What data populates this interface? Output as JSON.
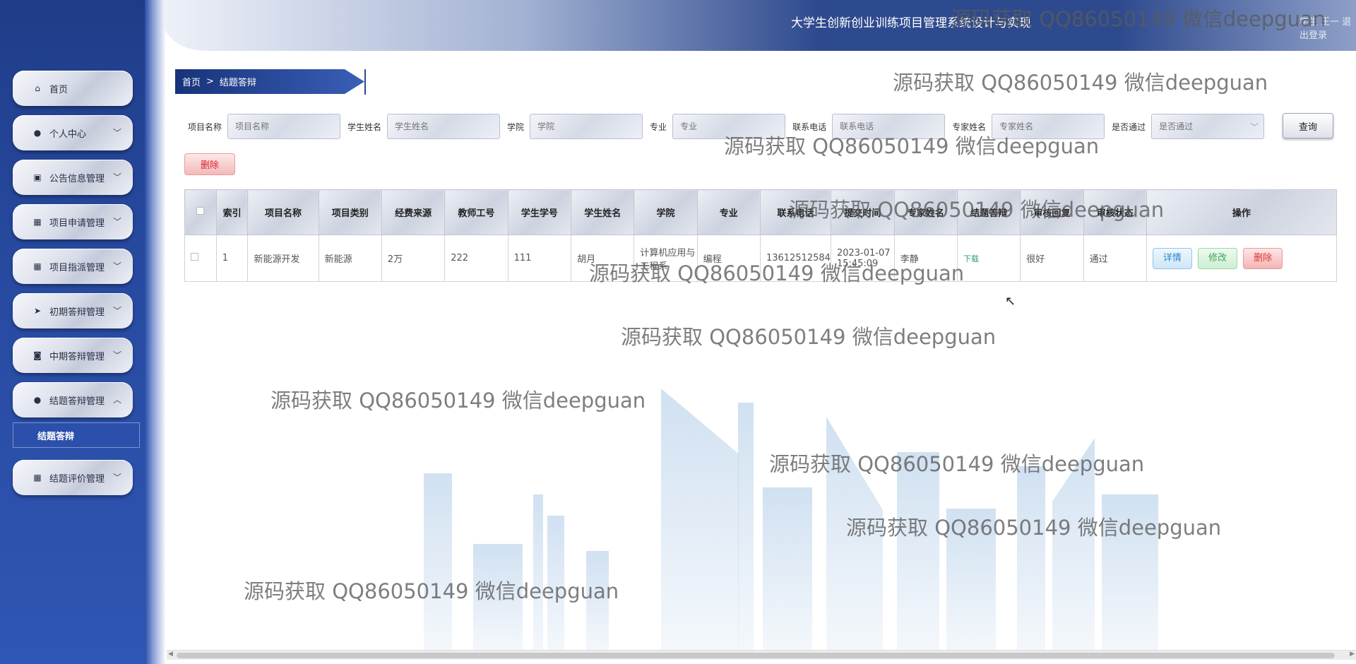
{
  "header": {
    "title": "大学生创新创业训练项目管理系统设计与实现",
    "user_text": "学生 王一 退出登录"
  },
  "sidebar": {
    "items": [
      {
        "label": "首页",
        "icon": "home-icon",
        "glyph": "⌂",
        "has_chevron": false
      },
      {
        "label": "个人中心",
        "icon": "user-icon",
        "glyph": "●",
        "has_chevron": true
      },
      {
        "label": "公告信息管理",
        "icon": "clipboard-icon",
        "glyph": "▣",
        "has_chevron": true
      },
      {
        "label": "项目申请管理",
        "icon": "grid-icon",
        "glyph": "▦",
        "has_chevron": true
      },
      {
        "label": "项目指派管理",
        "icon": "grid-icon",
        "glyph": "▦",
        "has_chevron": true
      },
      {
        "label": "初期答辩管理",
        "icon": "send-icon",
        "glyph": "➤",
        "has_chevron": true
      },
      {
        "label": "中期答辩管理",
        "icon": "video-icon",
        "glyph": "◙",
        "has_chevron": true
      },
      {
        "label": "结题答辩管理",
        "icon": "lightbulb-icon",
        "glyph": "●",
        "has_chevron": true,
        "expanded": true
      }
    ],
    "submenu_label": "结题答辩",
    "last_item": {
      "label": "结题评价管理",
      "icon": "grid-icon",
      "glyph": "▦"
    }
  },
  "breadcrumb": {
    "home": "首页",
    "sep": ">",
    "current": "结题答辩"
  },
  "search": {
    "fields": [
      {
        "label": "项目名称",
        "placeholder": "项目名称"
      },
      {
        "label": "学生姓名",
        "placeholder": "学生姓名"
      },
      {
        "label": "学院",
        "placeholder": "学院"
      },
      {
        "label": "专业",
        "placeholder": "专业"
      },
      {
        "label": "联系电话",
        "placeholder": "联系电话"
      },
      {
        "label": "专家姓名",
        "placeholder": "专家姓名"
      }
    ],
    "pass_label": "是否通过",
    "pass_placeholder": "是否通过",
    "query_button": "查询"
  },
  "delete_button": "删除",
  "table": {
    "headers": [
      "索引",
      "项目名称",
      "项目类别",
      "经费来源",
      "教师工号",
      "学生学号",
      "学生姓名",
      "学院",
      "专业",
      "联系电话",
      "提交时间",
      "专家姓名",
      "结题答辩",
      "审核回复",
      "审核状态",
      "操作"
    ],
    "rows": [
      {
        "index": "1",
        "name": "新能源开发",
        "category": "新能源",
        "funding": "2万",
        "teacher_id": "222",
        "student_id": "111",
        "student_name": "胡月",
        "college": "计算机应用与工程系",
        "major": "编程",
        "phone": "13612512584",
        "time": "2023-01-07 15:45:09",
        "expert": "李静",
        "download": "下载",
        "reply": "很好",
        "status": "通过"
      }
    ],
    "ops": {
      "detail": "详情",
      "edit": "修改",
      "delete": "删除"
    }
  },
  "watermark": "源码获取 QQ86050149 微信deepguan"
}
